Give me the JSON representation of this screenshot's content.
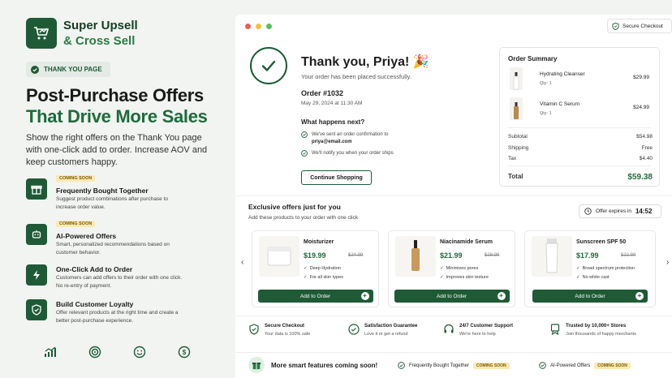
{
  "brand": {
    "line1": "Super Upsell",
    "line2": "& Cross Sell"
  },
  "hero": {
    "pill": "THANK YOU PAGE",
    "title1": "Post-Purchase Offers",
    "title2": "That Drive More Sales",
    "subtitle": "Show the right offers on the Thank You page with one-click add to order. Increase AOV and keep customers happy."
  },
  "features": [
    {
      "badge": "COMING SOON",
      "title": "Frequently Bought Together",
      "desc": "Suggest product combinations after purchase to increase order value.",
      "icon": "gift-icon"
    },
    {
      "badge": "COMING SOON",
      "title": "AI-Powered Offers",
      "desc": "Smart, personalized recommendations based on customer behavior.",
      "icon": "robot-icon"
    },
    {
      "badge": "",
      "title": "One-Click Add to Order",
      "desc": "Customers can add offers to their order with one click. No re-entry of payment.",
      "icon": "lightning-icon"
    },
    {
      "badge": "",
      "title": "Build Customer Loyalty",
      "desc": "Offer relevant products at the right time and create a better post-purchase experience.",
      "icon": "shield-icon"
    }
  ],
  "bottom_icons": [
    "chart-icon",
    "target-icon",
    "smile-icon",
    "dollar-icon"
  ],
  "secure_checkout": "Secure Checkout",
  "thankyou": {
    "title": "Thank you, Priya! 🎉",
    "subtitle": "Your order has been placed successfully.",
    "order_no": "Order #1032",
    "date": "May 29, 2024 at 11:30 AM",
    "next_title": "What happens next?",
    "next1a": "We've sent an order confirmation to",
    "next1b": "priya@email.com",
    "next2": "We'll notify you when your order ships",
    "continue": "Continue Shopping"
  },
  "summary": {
    "title": "Order Summary",
    "items": [
      {
        "name": "Hydrating Cleanser",
        "qty": "Qty: 1",
        "price": "$29.99"
      },
      {
        "name": "Vitamin C Serum",
        "qty": "Qty: 1",
        "price": "$24.99"
      }
    ],
    "subtotal_label": "Subtotal",
    "subtotal": "$54.98",
    "shipping_label": "Shipping",
    "shipping": "Free",
    "tax_label": "Tax",
    "tax": "$4.40",
    "total_label": "Total",
    "total": "$59.38"
  },
  "offers": {
    "title": "Exclusive offers just for you",
    "subtitle": "Add these products to your order with one click",
    "expire_label": "Offer expires in",
    "expire_time": "14:52",
    "add_label": "Add to Order",
    "products": [
      {
        "name": "Moisturizer",
        "price": "$19.99",
        "old": "$24.99",
        "f1": "Deep Hydration",
        "f2": "For all skin types"
      },
      {
        "name": "Niacinamide Serum",
        "price": "$21.99",
        "old": "$28.99",
        "f1": "Minimizes pores",
        "f2": "Improves skin texture"
      },
      {
        "name": "Sunscreen SPF 50",
        "price": "$17.99",
        "old": "$22.99",
        "f1": "Broad spectrum protection",
        "f2": "No white cast"
      }
    ]
  },
  "trust": [
    {
      "title": "Secure Checkout",
      "desc": "Your data is 100% safe",
      "icon": "shield-check-icon"
    },
    {
      "title": "Satisfaction Guarantee",
      "desc": "Love it or get a refund",
      "icon": "check-circle-icon"
    },
    {
      "title": "24/7 Customer Support",
      "desc": "We're here to help",
      "icon": "headset-icon"
    },
    {
      "title": "Trusted by 10,000+ Stores",
      "desc": "Join thousands of happy merchants",
      "icon": "badge-icon"
    }
  ],
  "strip": {
    "title": "More smart features coming soon!",
    "item1": "Frequently Bought Together",
    "item2": "AI-Powered Offers",
    "coming": "COMING SOON"
  },
  "colors": {
    "primary": "#1e5a36",
    "accent": "#2c7a45",
    "badge": "#fbe9b4"
  }
}
